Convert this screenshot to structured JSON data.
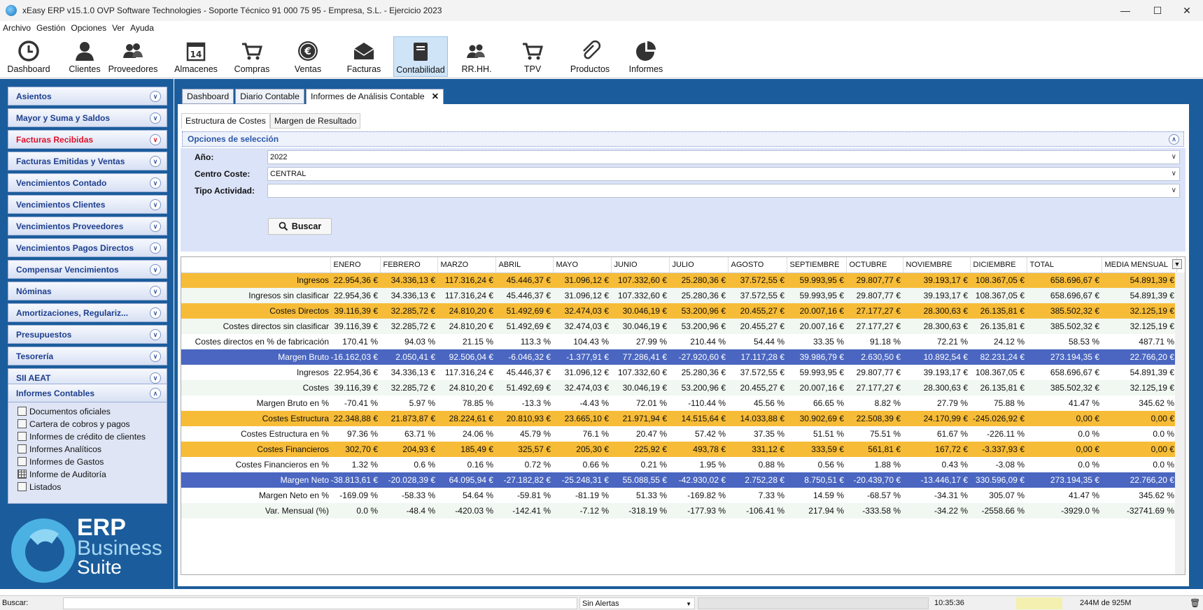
{
  "window": {
    "title": "xEasy ERP v15.1.0 OVP Software Technologies - Soporte Técnico 91 000 75 95 - Empresa, S.L. - Ejercicio 2023"
  },
  "menu": [
    "Archivo",
    "Gestión",
    "Opciones",
    "Ver",
    "Ayuda"
  ],
  "toolbar": [
    {
      "label": "Dashboard",
      "icon": "clock-icon"
    },
    {
      "label": "Clientes",
      "icon": "user-icon"
    },
    {
      "label": "Proveedores",
      "icon": "users-icon"
    },
    {
      "label": "Almacenes",
      "icon": "calendar-icon"
    },
    {
      "label": "Compras",
      "icon": "cart-icon"
    },
    {
      "label": "Ventas",
      "icon": "euro-icon"
    },
    {
      "label": "Facturas",
      "icon": "envelope-icon"
    },
    {
      "label": "Contabilidad",
      "icon": "book-icon"
    },
    {
      "label": "RR.HH.",
      "icon": "people-icon"
    },
    {
      "label": "TPV",
      "icon": "pos-cart-icon"
    },
    {
      "label": "Productos",
      "icon": "paperclip-icon"
    },
    {
      "label": "Informes",
      "icon": "pie-chart-icon"
    }
  ],
  "sidebar": {
    "sections": [
      "Asientos",
      "Mayor y Suma y Saldos",
      "Facturas Recibidas",
      "Facturas Emitidas y Ventas",
      "Vencimientos Contado",
      "Vencimientos Clientes",
      "Vencimientos Proveedores",
      "Vencimientos Pagos Directos",
      "Compensar Vencimientos",
      "Nóminas",
      "Amortizaciones, Regulariz...",
      "Presupuestos",
      "Tesorería",
      "SII AEAT",
      "Informes Contables"
    ],
    "highlight_color": "#e0102a",
    "informes_items": [
      "Documentos oficiales",
      "Cartera de cobros y pagos",
      "Informes de crédito de clientes",
      "Informes Analíticos",
      "Informes de Gastos",
      "Informe de Auditoría",
      "Listados"
    ]
  },
  "logo": {
    "line1": "ERP",
    "line2": "Business",
    "line3": "Suite"
  },
  "tabs": [
    "Dashboard",
    "Diario Contable",
    "Informes de Análisis Contable"
  ],
  "subtabs": [
    "Estructura de Costes",
    "Margen de Resultado"
  ],
  "options": {
    "header": "Opciones de selección",
    "anio_label": "Año:",
    "anio_value": "2022",
    "centro_label": "Centro Coste:",
    "centro_value": "CENTRAL",
    "tipo_label": "Tipo Actividad:",
    "tipo_value": "",
    "buscar": "Buscar"
  },
  "table": {
    "columns": [
      "ENERO",
      "FEBRERO",
      "MARZO",
      "ABRIL",
      "MAYO",
      "JUNIO",
      "JULIO",
      "AGOSTO",
      "SEPTIEMBRE",
      "OCTUBRE",
      "NOVIEMBRE",
      "DICIEMBRE",
      "TOTAL",
      "MEDIA MENSUAL"
    ],
    "rows": [
      {
        "style": "orange",
        "label": "Ingresos",
        "values": [
          "22.954,36 €",
          "34.336,13 €",
          "117.316,24 €",
          "45.446,37 €",
          "31.096,12 €",
          "107.332,60 €",
          "25.280,36 €",
          "37.572,55 €",
          "59.993,95 €",
          "29.807,77 €",
          "39.193,17 €",
          "108.367,05 €",
          "658.696,67 €",
          "54.891,39 €"
        ]
      },
      {
        "style": "lgreen",
        "label": "Ingresos sin clasificar",
        "values": [
          "22.954,36 €",
          "34.336,13 €",
          "117.316,24 €",
          "45.446,37 €",
          "31.096,12 €",
          "107.332,60 €",
          "25.280,36 €",
          "37.572,55 €",
          "59.993,95 €",
          "29.807,77 €",
          "39.193,17 €",
          "108.367,05 €",
          "658.696,67 €",
          "54.891,39 €"
        ]
      },
      {
        "style": "orange",
        "label": "Costes Directos",
        "values": [
          "39.116,39 €",
          "32.285,72 €",
          "24.810,20 €",
          "51.492,69 €",
          "32.474,03 €",
          "30.046,19 €",
          "53.200,96 €",
          "20.455,27 €",
          "20.007,16 €",
          "27.177,27 €",
          "28.300,63 €",
          "26.135,81 €",
          "385.502,32 €",
          "32.125,19 €"
        ]
      },
      {
        "style": "lgreen",
        "label": "Costes directos sin clasificar",
        "values": [
          "39.116,39 €",
          "32.285,72 €",
          "24.810,20 €",
          "51.492,69 €",
          "32.474,03 €",
          "30.046,19 €",
          "53.200,96 €",
          "20.455,27 €",
          "20.007,16 €",
          "27.177,27 €",
          "28.300,63 €",
          "26.135,81 €",
          "385.502,32 €",
          "32.125,19 €"
        ]
      },
      {
        "style": "white",
        "label": "Costes directos en % de fabricación",
        "values": [
          "170.41 %",
          "94.03 %",
          "21.15 %",
          "113.3 %",
          "104.43 %",
          "27.99 %",
          "210.44 %",
          "54.44 %",
          "33.35 %",
          "91.18 %",
          "72.21 %",
          "24.12 %",
          "58.53 %",
          "487.71 %"
        ]
      },
      {
        "style": "blue",
        "label": "Margen Bruto",
        "values": [
          "-16.162,03 €",
          "2.050,41 €",
          "92.506,04 €",
          "-6.046,32 €",
          "-1.377,91 €",
          "77.286,41 €",
          "-27.920,60 €",
          "17.117,28 €",
          "39.986,79 €",
          "2.630,50 €",
          "10.892,54 €",
          "82.231,24 €",
          "273.194,35 €",
          "22.766,20 €"
        ]
      },
      {
        "style": "white",
        "label": "Ingresos",
        "values": [
          "22.954,36 €",
          "34.336,13 €",
          "117.316,24 €",
          "45.446,37 €",
          "31.096,12 €",
          "107.332,60 €",
          "25.280,36 €",
          "37.572,55 €",
          "59.993,95 €",
          "29.807,77 €",
          "39.193,17 €",
          "108.367,05 €",
          "658.696,67 €",
          "54.891,39 €"
        ]
      },
      {
        "style": "lgreen",
        "label": "Costes",
        "values": [
          "39.116,39 €",
          "32.285,72 €",
          "24.810,20 €",
          "51.492,69 €",
          "32.474,03 €",
          "30.046,19 €",
          "53.200,96 €",
          "20.455,27 €",
          "20.007,16 €",
          "27.177,27 €",
          "28.300,63 €",
          "26.135,81 €",
          "385.502,32 €",
          "32.125,19 €"
        ]
      },
      {
        "style": "white",
        "label": "Margen Bruto en %",
        "values": [
          "-70.41 %",
          "5.97 %",
          "78.85 %",
          "-13.3 %",
          "-4.43 %",
          "72.01 %",
          "-110.44 %",
          "45.56 %",
          "66.65 %",
          "8.82 %",
          "27.79 %",
          "75.88 %",
          "41.47 %",
          "345.62 %"
        ]
      },
      {
        "style": "orange",
        "label": "Costes Estructura",
        "values": [
          "22.348,88 €",
          "21.873,87 €",
          "28.224,61 €",
          "20.810,93 €",
          "23.665,10 €",
          "21.971,94 €",
          "14.515,64 €",
          "14.033,88 €",
          "30.902,69 €",
          "22.508,39 €",
          "24.170,99 €",
          "-245.026,92 €",
          "0,00 €",
          "0,00 €"
        ]
      },
      {
        "style": "white",
        "label": "Costes Estructura en %",
        "values": [
          "97.36 %",
          "63.71 %",
          "24.06 %",
          "45.79 %",
          "76.1 %",
          "20.47 %",
          "57.42 %",
          "37.35 %",
          "51.51 %",
          "75.51 %",
          "61.67 %",
          "-226.11 %",
          "0.0 %",
          "0.0 %"
        ]
      },
      {
        "style": "orange",
        "label": "Costes Financieros",
        "values": [
          "302,70 €",
          "204,93 €",
          "185,49 €",
          "325,57 €",
          "205,30 €",
          "225,92 €",
          "493,78 €",
          "331,12 €",
          "333,59 €",
          "561,81 €",
          "167,72 €",
          "-3.337,93 €",
          "0,00 €",
          "0,00 €"
        ]
      },
      {
        "style": "white",
        "label": "Costes Financieros en %",
        "values": [
          "1.32 %",
          "0.6 %",
          "0.16 %",
          "0.72 %",
          "0.66 %",
          "0.21 %",
          "1.95 %",
          "0.88 %",
          "0.56 %",
          "1.88 %",
          "0.43 %",
          "-3.08 %",
          "0.0 %",
          "0.0 %"
        ]
      },
      {
        "style": "blue",
        "label": "Margen Neto",
        "values": [
          "-38.813,61 €",
          "-20.028,39 €",
          "64.095,94 €",
          "-27.182,82 €",
          "-25.248,31 €",
          "55.088,55 €",
          "-42.930,02 €",
          "2.752,28 €",
          "8.750,51 €",
          "-20.439,70 €",
          "-13.446,17 €",
          "330.596,09 €",
          "273.194,35 €",
          "22.766,20 €"
        ]
      },
      {
        "style": "white",
        "label": "Margen Neto en %",
        "values": [
          "-169.09 %",
          "-58.33 %",
          "54.64 %",
          "-59.81 %",
          "-81.19 %",
          "51.33 %",
          "-169.82 %",
          "7.33 %",
          "14.59 %",
          "-68.57 %",
          "-34.31 %",
          "305.07 %",
          "41.47 %",
          "345.62 %"
        ]
      },
      {
        "style": "lgreen",
        "label": "Var. Mensual (%)",
        "values": [
          "0.0 %",
          "-48.4 %",
          "-420.03 %",
          "-142.41 %",
          "-7.12 %",
          "-318.19 %",
          "-177.93 %",
          "-106.41 %",
          "217.94 %",
          "-333.58 %",
          "-34.22 %",
          "-2558.66 %",
          "-3929.0 %",
          "-32741.69 %"
        ]
      }
    ]
  },
  "status": {
    "buscar_label": "Buscar:",
    "alerts": "Sin Alertas",
    "time": "10:35:36",
    "memory": "244M de 925M"
  }
}
